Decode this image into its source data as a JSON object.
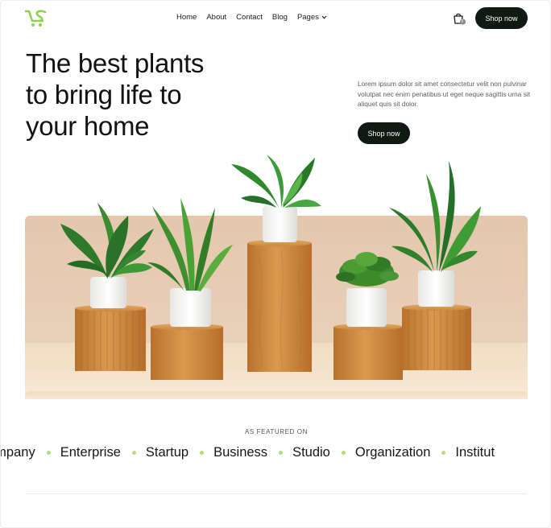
{
  "header": {
    "logo_name": "cart-logo",
    "nav": [
      {
        "label": "Home"
      },
      {
        "label": "About"
      },
      {
        "label": "Contact"
      },
      {
        "label": "Blog"
      },
      {
        "label": "Pages"
      }
    ],
    "cart_badge": "0",
    "cta_label": "Shop now"
  },
  "hero": {
    "title_lines": [
      "The best plants",
      "to bring life to",
      "your home"
    ],
    "description": "Lorem ipsum dolor sit amet consectetur velit non pulvinar volutpat nec enim penatibus ut eget neque sagittis urna sit aliquet quis sit dolor.",
    "cta_label": "Shop now"
  },
  "featured": {
    "label": "AS FEATURED ON",
    "brands": [
      "ompany",
      "Enterprise",
      "Startup",
      "Business",
      "Studio",
      "Organization",
      "Institut"
    ]
  },
  "colors": {
    "accent_green": "#8fd14f",
    "dark_button": "#0f1a14",
    "image_wall": "#e6cbb3",
    "image_floor": "#f3e3cc",
    "pedestal_wood": "#cf8a3d",
    "leaf_green": "#2f7d2f",
    "pot_white": "#f4f4f2"
  }
}
